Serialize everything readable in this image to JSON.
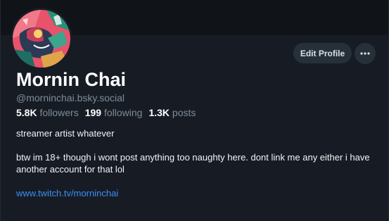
{
  "profile": {
    "display_name": "Mornin Chai",
    "handle": "@morninchai.bsky.social",
    "stats": {
      "followers_count": "5.8K",
      "followers_label": "followers",
      "following_count": "199",
      "following_label": "following",
      "posts_count": "1.3K",
      "posts_label": "posts"
    },
    "bio": {
      "line1": "streamer artist whatever",
      "line2": "btw im 18+ though i wont post anything too naughty here. dont link me any either i have another account for that lol",
      "link": "www.twitch.tv/morninchai"
    }
  },
  "actions": {
    "edit_profile_label": "Edit Profile",
    "more_icon": "more-horizontal-icon"
  },
  "colors": {
    "background": "#171c24",
    "text_primary": "#ffffff",
    "text_secondary": "#7e8b98",
    "link": "#3b8ff5",
    "button_bg": "#263039"
  }
}
